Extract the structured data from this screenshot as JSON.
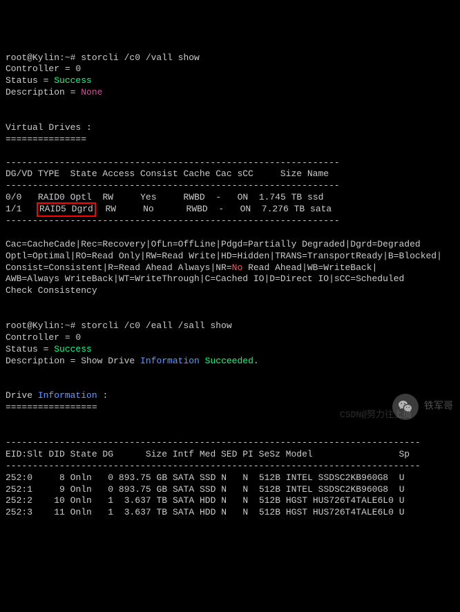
{
  "cmd1": {
    "prompt": "root@Kylin:~# ",
    "command": "storcli /c0 /vall show",
    "controller_label": "Controller = ",
    "controller_val": "0",
    "status_label": "Status = ",
    "status_val": "Success",
    "desc_label": "Description = ",
    "desc_val": "None"
  },
  "vd_section": {
    "title": "Virtual Drives :",
    "divider": "===============",
    "header": "DG/VD TYPE  State Access Consist Cache Cac sCC     Size Name",
    "dashline": "--------------------------------------------------------------",
    "rows": [
      {
        "dgvd": "0/0",
        "type": "RAID0",
        "state": "Optl",
        "access": "RW",
        "consist": "Yes",
        "cache": "RWBD",
        "cac": "-",
        "scc": "ON",
        "size": "1.745 TB",
        "name": "ssd"
      },
      {
        "dgvd": "1/1",
        "type": "RAID5",
        "state": "Dgrd",
        "access": "RW",
        "consist": "No",
        "cache": "RWBD",
        "cac": "-",
        "scc": "ON",
        "size": "7.276 TB",
        "name": "sata"
      }
    ]
  },
  "legend": {
    "l1": "Cac=CacheCade|Rec=Recovery|OfLn=OffLine|Pdgd=Partially Degraded|Dgrd=Degraded",
    "l2": "Optl=Optimal|RO=Read Only|RW=Read Write|HD=Hidden|TRANS=TransportReady|B=Blocked|",
    "l3a": "Consist=Consistent|R=Read Ahead Always|NR=",
    "l3b": "No",
    "l3c": " Read Ahead|WB=WriteBack|",
    "l4": "AWB=Always WriteBack|WT=WriteThrough|C=Cached IO|D=Direct IO|sCC=Scheduled",
    "l5": "Check Consistency"
  },
  "cmd2": {
    "prompt": "root@Kylin:~# ",
    "command": "storcli /c0 /eall /sall show",
    "controller_label": "Controller = ",
    "controller_val": "0",
    "status_label": "Status = ",
    "status_val": "Success",
    "desc_label": "Description = Show Drive ",
    "desc_info": "Information",
    "desc_succ": " Succeeded",
    "desc_end": "."
  },
  "drive_section": {
    "title_a": "Drive ",
    "title_b": "Information",
    "title_c": " :",
    "divider": "=================",
    "dashline": "-----------------------------------------------------------------------------",
    "header": "EID:Slt DID State DG      Size Intf Med SED PI SeSz Model                Sp",
    "rows": [
      {
        "eidslt": "252:0",
        "did": "8",
        "state": "Onln",
        "dg": "0",
        "size": "893.75 GB",
        "intf": "SATA",
        "med": "SSD",
        "sed": "N",
        "pi": "N",
        "sesz": "512B",
        "model": "INTEL SSDSC2KB960G8",
        "sp": "U"
      },
      {
        "eidslt": "252:1",
        "did": "9",
        "state": "Onln",
        "dg": "0",
        "size": "893.75 GB",
        "intf": "SATA",
        "med": "SSD",
        "sed": "N",
        "pi": "N",
        "sesz": "512B",
        "model": "INTEL SSDSC2KB960G8",
        "sp": "U"
      },
      {
        "eidslt": "252:2",
        "did": "10",
        "state": "Onln",
        "dg": "1",
        "size": "3.637 TB",
        "intf": "SATA",
        "med": "HDD",
        "sed": "N",
        "pi": "N",
        "sesz": "512B",
        "model": "HGST HUS726T4TALE6L0",
        "sp": "U"
      },
      {
        "eidslt": "252:3",
        "did": "11",
        "state": "Onln",
        "dg": "1",
        "size": "3.637 TB",
        "intf": "SATA",
        "med": "HDD",
        "sed": "N",
        "pi": "N",
        "sesz": "512B",
        "model": "HGST HUS726T4TALE6L0",
        "sp": "U"
      }
    ]
  },
  "watermark": {
    "text1": "铁军哥",
    "text2": "CSDN@努力往上搞"
  }
}
